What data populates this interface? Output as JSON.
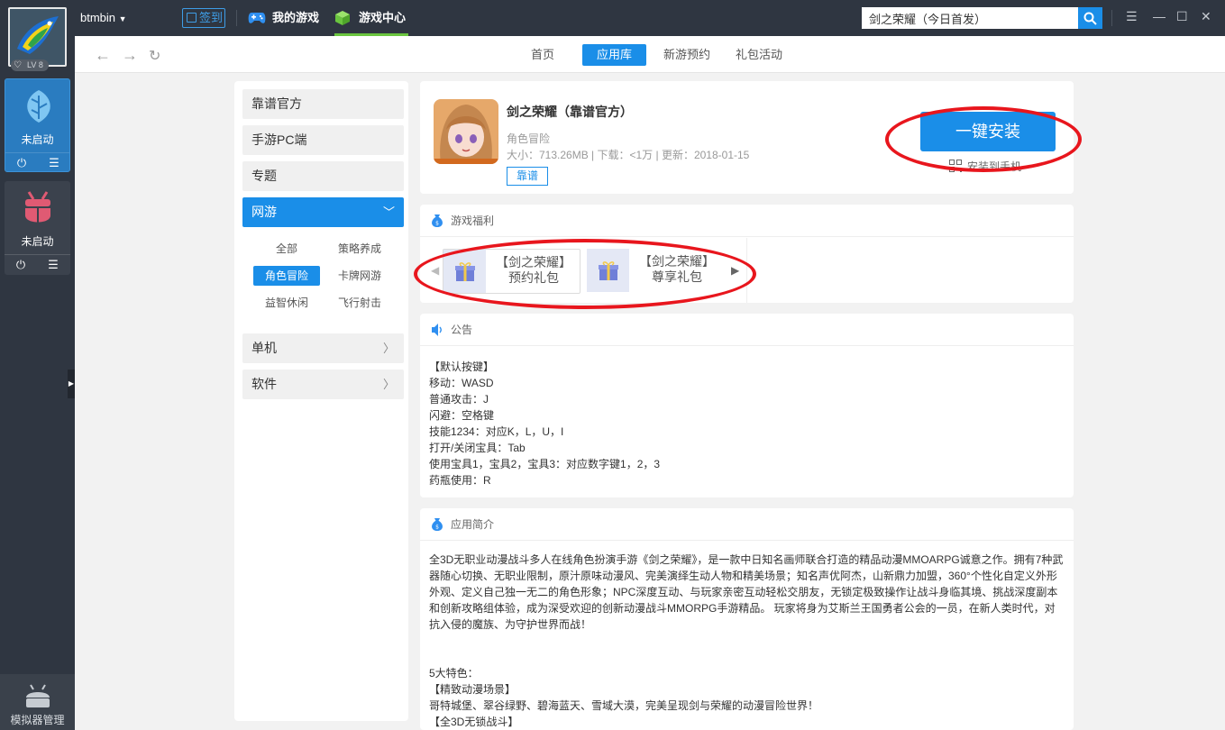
{
  "sidebar": {
    "level": "LV 8",
    "emulators": [
      {
        "status": "未启动",
        "power_icon": "power-icon",
        "menu_icon": "menu-icon"
      },
      {
        "status": "未启动",
        "power_icon": "power-icon",
        "menu_icon": "menu-icon"
      }
    ],
    "manager_label": "模拟器管理"
  },
  "topbar": {
    "username": "btmbin",
    "signin_label": "签到",
    "tabs": [
      "我的游戏",
      "游戏中心"
    ],
    "active_tab": "游戏中心",
    "search_value": "剑之荣耀（今日首发）"
  },
  "subnav": {
    "tabs": [
      "首页",
      "应用库",
      "新游预约",
      "礼包活动"
    ],
    "active": "应用库"
  },
  "categories": {
    "top": [
      "靠谱官方",
      "手游PC端",
      "专题"
    ],
    "expanded": "网游",
    "subcategories": [
      "全部",
      "策略养成",
      "角色冒险",
      "卡牌网游",
      "益智休闲",
      "飞行射击"
    ],
    "active_subcategory": "角色冒险",
    "bottom": [
      "单机",
      "软件"
    ]
  },
  "app": {
    "title": "剑之荣耀（靠谱官方）",
    "category": "角色冒险",
    "meta": "大小：713.26MB | 下载：<1万 | 更新：2018-01-15",
    "tag": "靠谱",
    "install_label": "一键安装",
    "phone_install_label": "安装到手机"
  },
  "benefits": {
    "header": "游戏福利",
    "gifts": [
      {
        "line1": "【剑之荣耀】",
        "line2": "预约礼包"
      },
      {
        "line1": "【剑之荣耀】",
        "line2": "尊享礼包"
      }
    ]
  },
  "notice": {
    "header": "公告",
    "body": "【默认按键】\n移动：WASD\n普通攻击：J\n闪避：空格键\n技能1234：对应K，L，U，I\n打开/关闭宝具：Tab\n使用宝具1，宝具2，宝具3：对应数字键1，2，3\n药瓶使用：R"
  },
  "intro": {
    "header": "应用简介",
    "body": "全3D无职业动漫战斗多人在线角色扮演手游《剑之荣耀》，是一款中日知名画师联合打造的精品动漫MMOARPG诚意之作。拥有7种武器随心切换、无职业限制，原汁原味动漫风、完美演绎生动人物和精美场景；知名声优阿杰，山新鼎力加盟，360°个性化自定义外形外观、定义自己独一无二的角色形象；NPC深度互动、与玩家亲密互动轻松交朋友，无锁定极致操作让战斗身临其境、挑战深度副本和创新攻略组体验，成为深受欢迎的创新动漫战斗MMORPG手游精品。 玩家将身为艾斯兰王国勇者公会的一员，在新人类时代，对抗入侵的魔族、为守护世界而战！\n\n\n5大特色：\n【精致动漫场景】\n哥特城堡、翠谷绿野、碧海蓝天、雪域大漠，完美呈现剑与荣耀的动漫冒险世界！\n【全3D无锁战斗】"
  },
  "colors": {
    "accent": "#1a8ee8",
    "highlight_ellipse": "#e8161d",
    "tab_underline": "#6ac53f"
  }
}
